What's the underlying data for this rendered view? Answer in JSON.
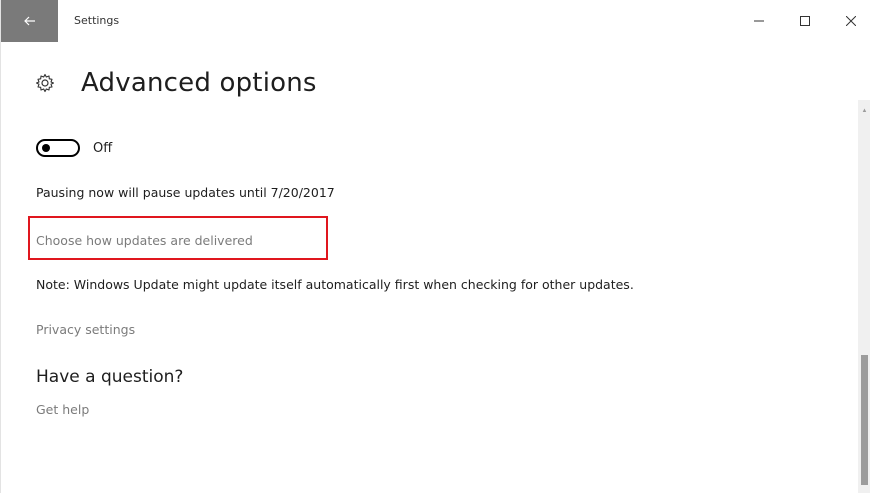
{
  "window": {
    "title": "Settings"
  },
  "controls": {
    "back_icon": "arrow-left-icon",
    "minimize_icon": "minimize-icon",
    "maximize_icon": "maximize-icon",
    "close_icon": "close-icon"
  },
  "header": {
    "icon": "gear-icon",
    "title": "Advanced options"
  },
  "pause_toggle": {
    "state": "Off"
  },
  "pause_text": "Pausing now will pause updates until 7/20/2017",
  "delivery_link": "Choose how updates are delivered",
  "note_text": "Note: Windows Update might update itself automatically first when checking for other updates.",
  "privacy_link": "Privacy settings",
  "question": {
    "heading": "Have a question?",
    "help_link": "Get help"
  },
  "colors": {
    "back_button_bg": "#7a7a7a",
    "link_gray": "#7b7b7b",
    "highlight_red": "#e0161e",
    "text_dark": "#1e1e1e"
  }
}
